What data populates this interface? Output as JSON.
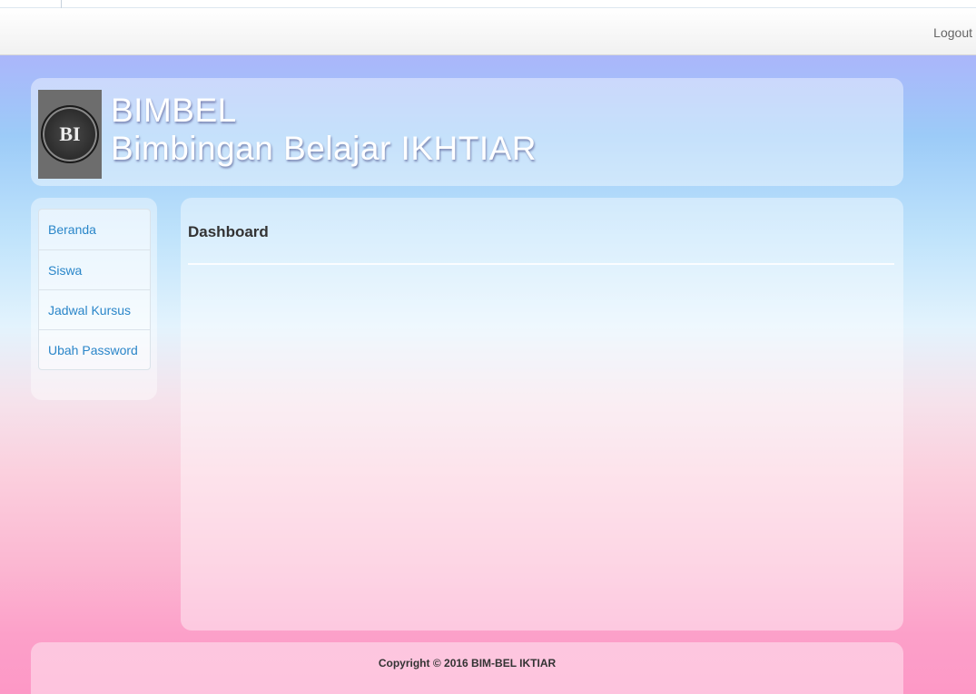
{
  "navbar": {
    "logout_label": "Logout"
  },
  "header": {
    "logo_text": "BI",
    "brand_line1": "BIMBEL",
    "brand_line2": "Bimbingan Belajar IKHTIAR"
  },
  "sidebar": {
    "items": [
      {
        "label": "Beranda"
      },
      {
        "label": "Siswa"
      },
      {
        "label": "Jadwal Kursus"
      },
      {
        "label": "Ubah Password"
      }
    ]
  },
  "main": {
    "title": "Dashboard"
  },
  "footer": {
    "copyright": "Copyright © 2016 BIM-BEL IKTIAR"
  },
  "colors": {
    "link": "#2a86c9",
    "bg_top": "#b2a9f7",
    "bg_mid": "#e3f3fd",
    "bg_bottom": "#fd98c6"
  }
}
